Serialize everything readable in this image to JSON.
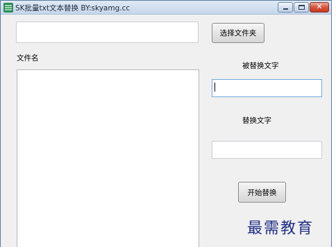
{
  "window": {
    "title": "SK批量txt文本替换 BY:skyamg.cc",
    "controls": {
      "minimize_icon": "minimize-icon",
      "maximize_icon": "maximize-icon",
      "close_glyph": "✕"
    }
  },
  "folder": {
    "path_value": "",
    "choose_button": "选择文件夹"
  },
  "file_list": {
    "header": "文件名",
    "items": []
  },
  "replace": {
    "find_label": "被替换文字",
    "find_value": "",
    "replace_label": "替换文字",
    "replace_value": "",
    "start_button": "开始替换"
  },
  "watermark": {
    "text": "最需教育"
  },
  "colors": {
    "titlebar": "#c6d7ec",
    "window_bg": "#f0f0f0",
    "close_button": "#c43a22",
    "watermark": "#1f2f86"
  }
}
